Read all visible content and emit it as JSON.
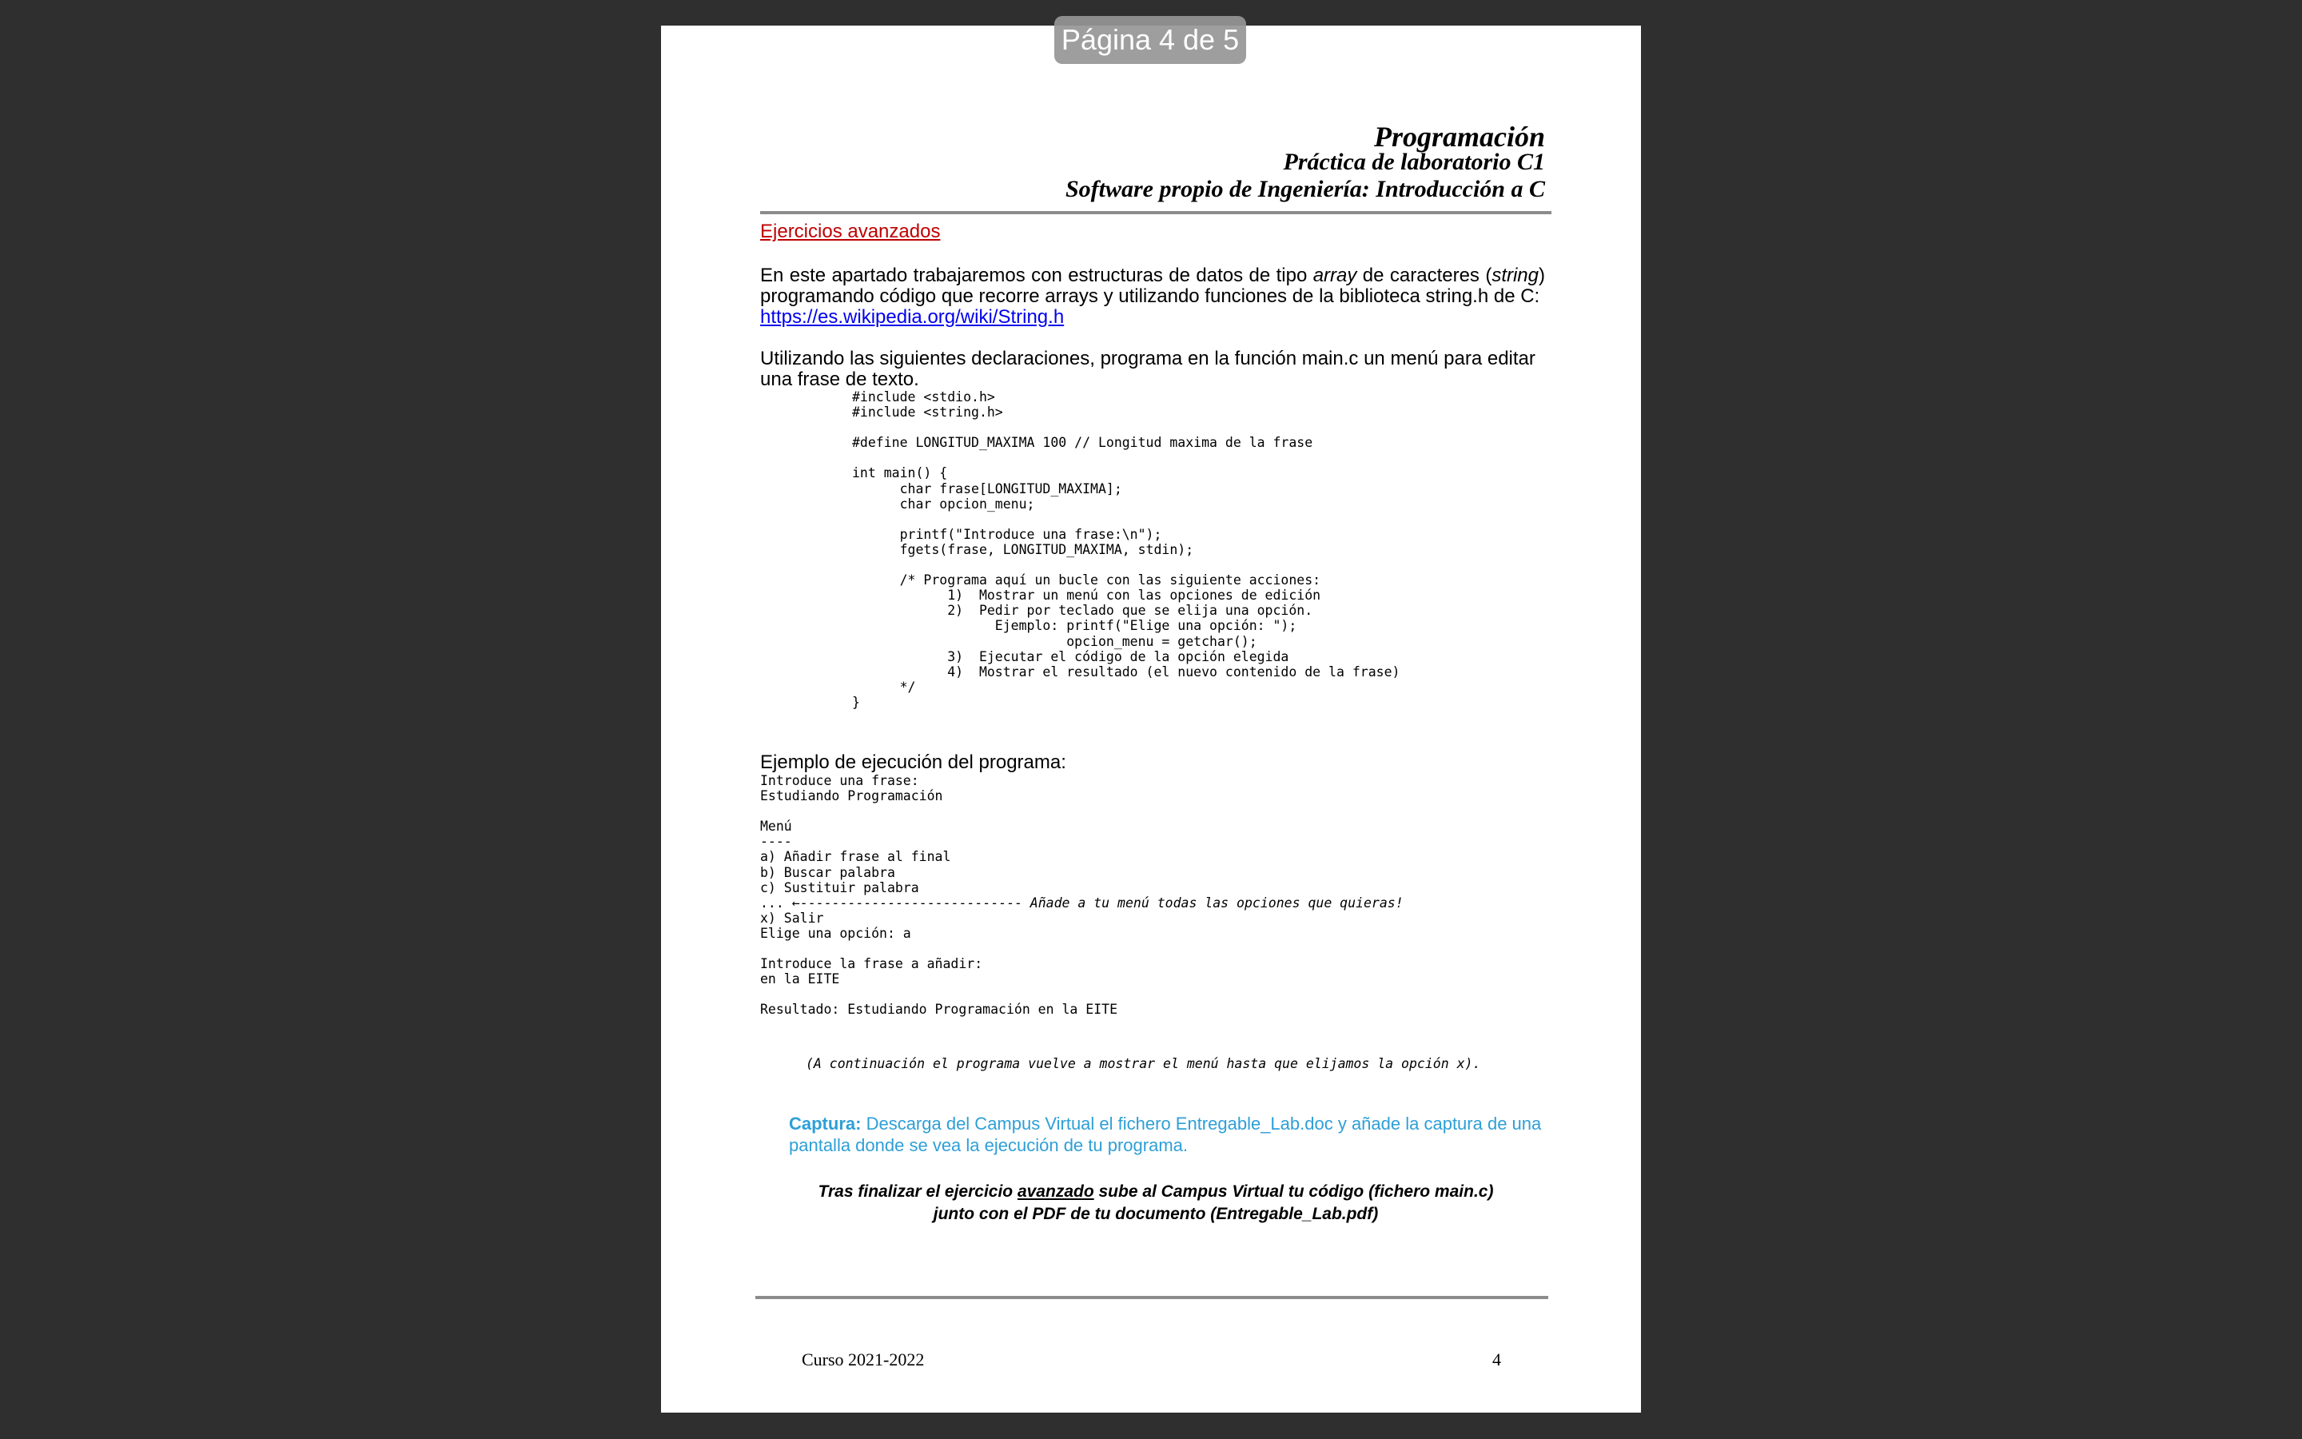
{
  "viewer": {
    "page_indicator": "Página 4 de 5"
  },
  "header": {
    "title": "Programación",
    "subtitle": "Práctica de laboratorio C1",
    "topic": "Software propio de Ingeniería: Introducción a C"
  },
  "section": {
    "title": "Ejercicios avanzados"
  },
  "intro": {
    "part1": "En este apartado trabajaremos con estructuras de datos de tipo ",
    "array_word": "array",
    "part2": " de caracteres (",
    "string_word": "string",
    "part3": ") programando código que recorre arrays y utilizando funciones de la biblioteca string.h de C:",
    "link": "https://es.wikipedia.org/wiki/String.h"
  },
  "instruction": "Utilizando las siguientes declaraciones, programa en la función main.c un menú para editar una frase de texto.",
  "code": "#include <stdio.h>\n#include <string.h>\n\n#define LONGITUD_MAXIMA 100 // Longitud maxima de la frase\n\nint main() {\n      char frase[LONGITUD_MAXIMA];\n      char opcion_menu;\n\n      printf(\"Introduce una frase:\\n\");\n      fgets(frase, LONGITUD_MAXIMA, stdin);\n\n      /* Programa aquí un bucle con las siguiente acciones:\n            1)  Mostrar un menú con las opciones de edición\n            2)  Pedir por teclado que se elija una opción.\n                  Ejemplo: printf(\"Elige una opción: \");\n                           opcion_menu = getchar();\n            3)  Ejecutar el código de la opción elegida\n            4)  Mostrar el resultado (el nuevo contenido de la frase)\n      */\n}",
  "example": {
    "title": "Ejemplo de ejecución del programa:",
    "lines_before": "Introduce una frase:\nEstudiando Programación\n\nMenú\n----\na) Añadir frase al final\nb) Buscar palabra\nc) Sustituir palabra",
    "arrow_line": "... ←---------------------------- ",
    "arrow_note": "Añade a tu menú todas las opciones que quieras!",
    "lines_after": "\nx) Salir\nElige una opción: a\n\nIntroduce la frase a añadir:\nen la EITE\n\nResultado: Estudiando Programación en la EITE",
    "note": "(A continuación el programa vuelve a mostrar el menú hasta que elijamos la opción x)."
  },
  "capture": {
    "label": "Captura:",
    "text": " Descarga del Campus Virtual el fichero Entregable_Lab.doc y añade la captura de una pantalla donde se vea la ejecución de tu programa."
  },
  "final": {
    "line1_a": "Tras finalizar el ejercicio ",
    "line1_u": "avanzado",
    "line1_b": " sube al Campus Virtual tu código (fichero main.c)",
    "line2": "junto con el PDF de tu documento (Entregable_Lab.pdf)"
  },
  "footer": {
    "course": "Curso 2021-2022",
    "page_number": "4"
  }
}
